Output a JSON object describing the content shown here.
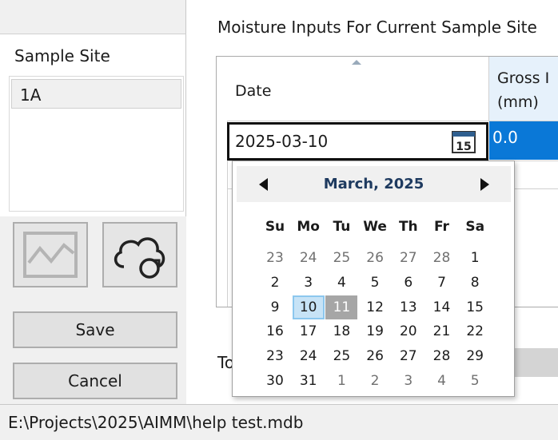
{
  "left": {
    "site_title": "Sample Site",
    "sites": [
      "1A"
    ],
    "save_label": "Save",
    "cancel_label": "Cancel"
  },
  "main": {
    "section_title": "Moisture Inputs For Current Sample Site",
    "columns": [
      "Date",
      "Gross I",
      "(mm)"
    ],
    "row": {
      "date": "2025-03-10",
      "gross": "0.0"
    },
    "total_label": "To"
  },
  "calendar": {
    "month": "March, 2025",
    "icon_day": "15",
    "dow": [
      "Su",
      "Mo",
      "Tu",
      "We",
      "Th",
      "Fr",
      "Sa"
    ],
    "weeks": [
      [
        "23",
        "24",
        "25",
        "26",
        "27",
        "28",
        "1"
      ],
      [
        "2",
        "3",
        "4",
        "5",
        "6",
        "7",
        "8"
      ],
      [
        "9",
        "10",
        "11",
        "12",
        "13",
        "14",
        "15"
      ],
      [
        "16",
        "17",
        "18",
        "19",
        "20",
        "21",
        "22"
      ],
      [
        "23",
        "24",
        "25",
        "26",
        "27",
        "28",
        "29"
      ],
      [
        "30",
        "31",
        "1",
        "2",
        "3",
        "4",
        "5"
      ]
    ],
    "today": "10",
    "selected": "11"
  },
  "status": {
    "path": "E:\\Projects\\2025\\AIMM\\help test.mdb"
  }
}
